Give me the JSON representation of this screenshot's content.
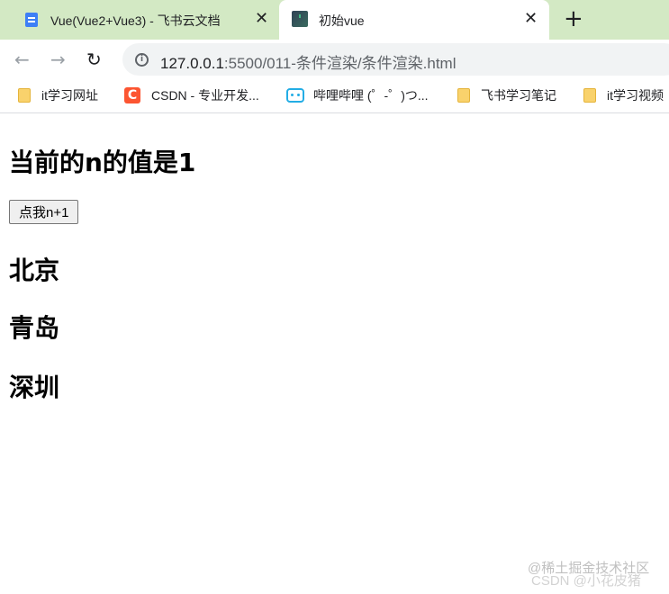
{
  "tabs": [
    {
      "title": "Vue(Vue2+Vue3) - 飞书云文档",
      "icon": "doc-icon",
      "active": false
    },
    {
      "title": "初始vue",
      "icon": "vue-icon",
      "active": true
    }
  ],
  "tab_close_glyph": "✕",
  "new_tab_glyph": "+",
  "nav": {
    "back": "←",
    "forward": "→",
    "reload": "↻"
  },
  "address": {
    "info_glyph": "i",
    "host": "127.0.0.1",
    "path": ":5500/011-条件渲染/条件渲染.html"
  },
  "bookmarks": [
    {
      "label": "it学习网址",
      "icon": "folder-icon"
    },
    {
      "label": "CSDN - 专业开发...",
      "icon": "csdn-icon",
      "icon_text": "C"
    },
    {
      "label": "哔哩哔哩 (゜-゜)つ...",
      "icon": "bilibili-icon"
    },
    {
      "label": "飞书学习笔记",
      "icon": "folder-icon"
    },
    {
      "label": "it学习视频",
      "icon": "folder-icon"
    }
  ],
  "page": {
    "heading": "当前的n的值是1",
    "button": "点我n+1",
    "cities": [
      "北京",
      "青岛",
      "深圳"
    ]
  },
  "watermark": {
    "line1": "@稀土掘金技术社区",
    "line2": "CSDN @小花皮猪"
  },
  "colors": {
    "tabstrip": "#d3e9c4",
    "omnibox": "#f1f3f4",
    "doc_icon": "#3d7ff6",
    "csdn_icon": "#fc5531",
    "bilibili_icon": "#23ade5",
    "folder_icon": "#f9d26c"
  }
}
